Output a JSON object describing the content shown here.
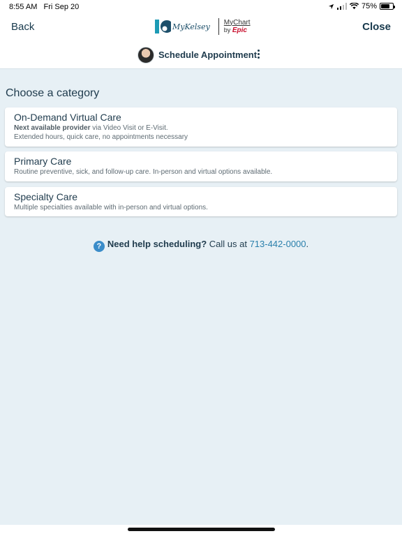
{
  "status": {
    "time": "8:55 AM",
    "date": "Fri Sep 20",
    "battery": "75%",
    "battery_level": 0.75
  },
  "nav": {
    "back_label": "Back",
    "close_label": "Close",
    "brand": "MyKelsey",
    "mychart": "MyChart",
    "by": "by",
    "epic": "Epic"
  },
  "header": {
    "title": "Schedule Appointment"
  },
  "main": {
    "heading": "Choose a category",
    "categories": [
      {
        "title": "On-Demand Virtual Care",
        "line1_bold": "Next available provider",
        "line1_rest": " via Video Visit or E-Visit.",
        "line2": "Extended hours, quick care, no appointments necessary"
      },
      {
        "title": "Primary Care",
        "line1": "Routine preventive, sick, and follow-up care. In-person and virtual options available."
      },
      {
        "title": "Specialty Care",
        "line1": "Multiple specialties available with in-person and virtual options."
      }
    ],
    "help": {
      "icon": "?",
      "bold": "Need help scheduling?",
      "text": " Call us at ",
      "phone": "713-442-0000",
      "end": "."
    }
  },
  "colors": {
    "accent": "#2a7fab",
    "background": "#e7f0f5",
    "text": "#1f3b4d",
    "help_icon": "#3a8cc9",
    "epic": "#c8102e"
  }
}
